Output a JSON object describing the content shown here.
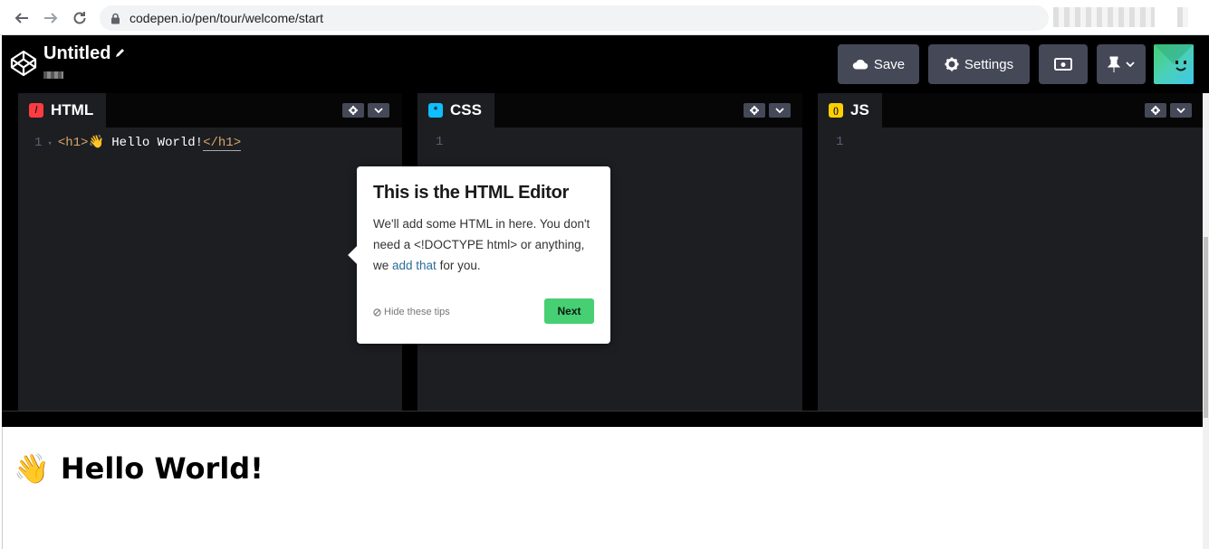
{
  "browser": {
    "url": "codepen.io/pen/tour/welcome/start"
  },
  "header": {
    "title": "Untitled",
    "buttons": {
      "save": "Save",
      "settings": "Settings"
    }
  },
  "editors": [
    {
      "name": "HTML",
      "icon_color": "#ff3c41",
      "icon_glyph": "/",
      "line_number": "1"
    },
    {
      "name": "CSS",
      "icon_color": "#0ebeff",
      "icon_glyph": "*",
      "line_number": "1"
    },
    {
      "name": "JS",
      "icon_color": "#fcd000",
      "icon_glyph": "()",
      "line_number": "1"
    }
  ],
  "html_code": {
    "open_tag": "<h1>",
    "content": "👋 Hello World!",
    "close_tag": "</h1>"
  },
  "preview": {
    "heading": "Hello World!",
    "emoji": "👋"
  },
  "tour": {
    "title": "This is the HTML Editor",
    "body_part1": "We'll add some HTML in here. You don't need a <!DOCTYPE html> or anything, we ",
    "body_link": "add that",
    "body_part2": " for you.",
    "hide_tips": "Hide these tips",
    "next": "Next"
  },
  "colors": {
    "accent_green": "#47cf73",
    "button_bg": "#444857",
    "editor_bg": "#1d1e22"
  }
}
